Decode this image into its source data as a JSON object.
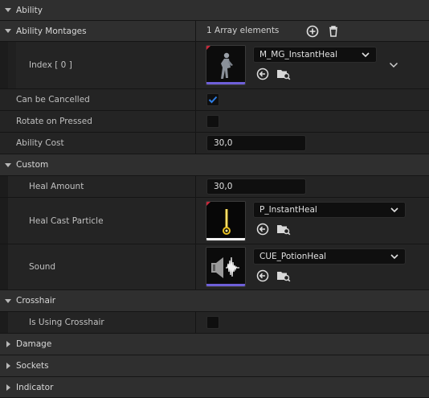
{
  "categories": {
    "ability": "Ability",
    "custom": "Custom",
    "crosshair": "Crosshair",
    "damage": "Damage",
    "sockets": "Sockets",
    "indicator": "Indicator"
  },
  "ability": {
    "montages_label": "Ability Montages",
    "montages_count": "1 Array elements",
    "index_label": "Index [ 0 ]",
    "montage_asset": "M_MG_InstantHeal",
    "can_be_cancelled_label": "Can be Cancelled",
    "can_be_cancelled": true,
    "rotate_on_pressed_label": "Rotate on Pressed",
    "rotate_on_pressed": false,
    "ability_cost_label": "Ability Cost",
    "ability_cost": "30,0"
  },
  "custom": {
    "heal_amount_label": "Heal Amount",
    "heal_amount": "30,0",
    "heal_cast_particle_label": "Heal Cast Particle",
    "heal_cast_particle_asset": "P_InstantHeal",
    "sound_label": "Sound",
    "sound_asset": "CUE_PotionHeal"
  },
  "crosshair": {
    "is_using_crosshair_label": "Is Using Crosshair",
    "is_using_crosshair": false
  },
  "icons": {
    "add": "plus-circle-icon",
    "delete": "trash-icon",
    "use_selected": "arrow-left-circle-icon",
    "browse": "folder-search-icon",
    "expand": "chevron-down-icon"
  },
  "colors": {
    "background": "#1a1a1a",
    "category_bg": "#2f2f2f",
    "row_bg": "#242424",
    "input_bg": "#0f0f0f",
    "checkbox_accent": "#1f6fd6",
    "anim_asset_underline": "#6e5fd8",
    "sound_asset_underline": "#6e5fd8"
  }
}
